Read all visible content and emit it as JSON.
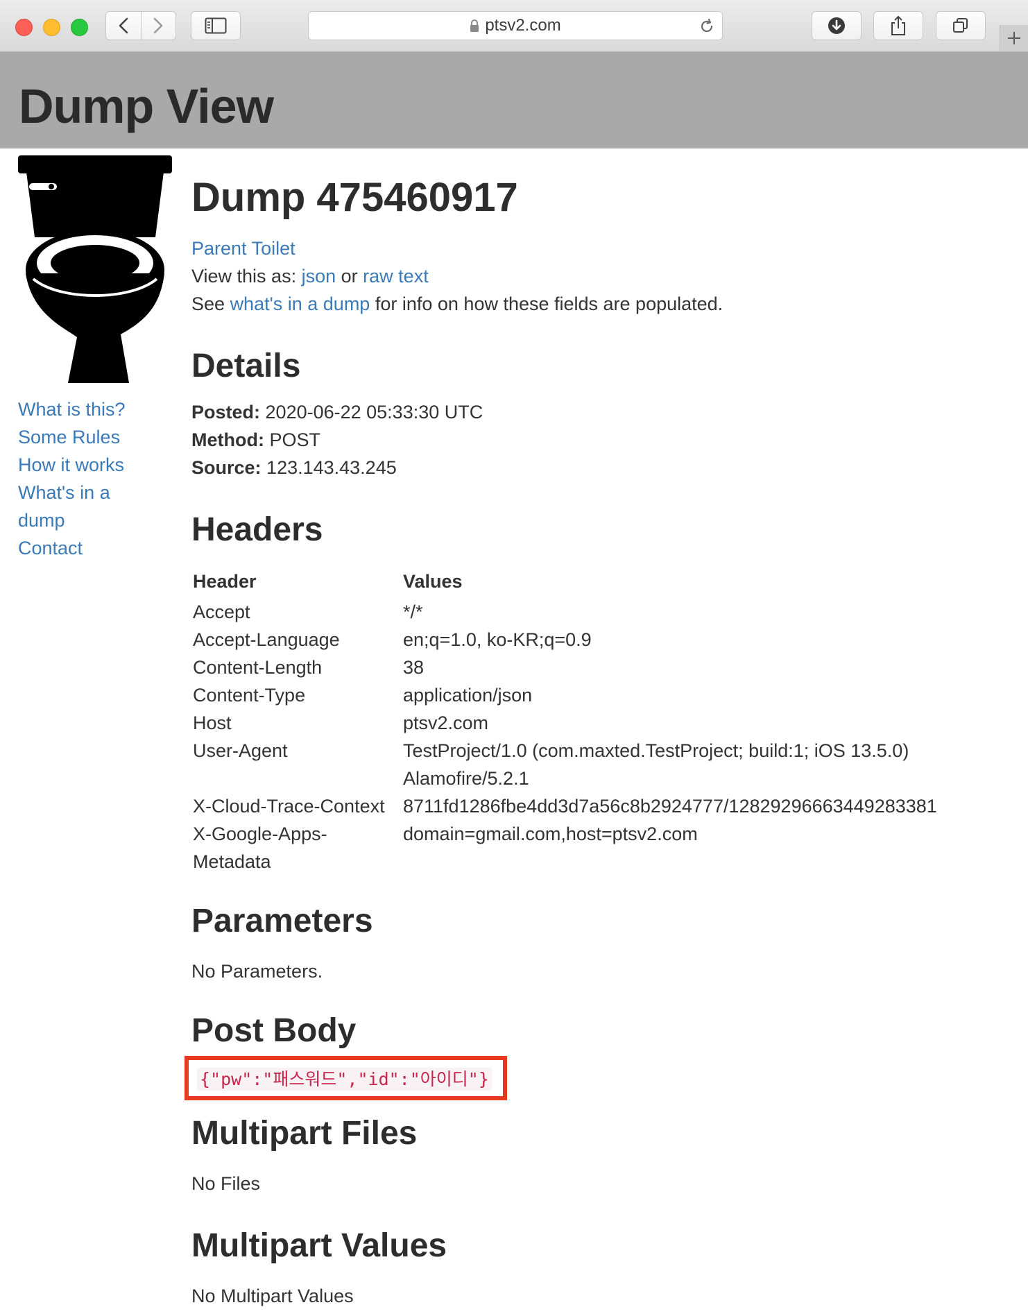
{
  "browser": {
    "url": "ptsv2.com"
  },
  "header": {
    "title": "Dump View"
  },
  "sidebar": {
    "links": [
      {
        "label": "What is this?"
      },
      {
        "label": "Some Rules"
      },
      {
        "label": "How it works"
      },
      {
        "label": "What's in a dump"
      },
      {
        "label": "Contact"
      }
    ]
  },
  "dump": {
    "title": "Dump 475460917",
    "parent_link": "Parent Toilet",
    "view_as_prefix": "View this as:",
    "json_link": "json",
    "or_text": "or",
    "raw_link": "raw text",
    "see_prefix": "See",
    "whats_link": "what's in a dump",
    "see_suffix": "for info on how these fields are populated."
  },
  "details": {
    "heading": "Details",
    "posted_label": "Posted:",
    "posted_value": "2020-06-22 05:33:30 UTC",
    "method_label": "Method:",
    "method_value": "POST",
    "source_label": "Source:",
    "source_value": "123.143.43.245"
  },
  "headers": {
    "heading": "Headers",
    "col_header": "Header",
    "col_values": "Values",
    "rows": [
      {
        "name": "Accept",
        "value": "*/*"
      },
      {
        "name": "Accept-Language",
        "value": "en;q=1.0, ko-KR;q=0.9"
      },
      {
        "name": "Content-Length",
        "value": "38"
      },
      {
        "name": "Content-Type",
        "value": "application/json"
      },
      {
        "name": "Host",
        "value": "ptsv2.com"
      },
      {
        "name": "User-Agent",
        "value": "TestProject/1.0 (com.maxted.TestProject; build:1; iOS 13.5.0) Alamofire/5.2.1"
      },
      {
        "name": "X-Cloud-Trace-Context",
        "value": "8711fd1286fbe4dd3d7a56c8b2924777/12829296663449283381"
      },
      {
        "name": "X-Google-Apps-Metadata",
        "value": "domain=gmail.com,host=ptsv2.com"
      }
    ]
  },
  "parameters": {
    "heading": "Parameters",
    "text": "No Parameters."
  },
  "post_body": {
    "heading": "Post Body",
    "content": "{\"pw\":\"패스워드\",\"id\":\"아이디\"}"
  },
  "multipart_files": {
    "heading": "Multipart Files",
    "text": "No Files"
  },
  "multipart_values": {
    "heading": "Multipart Values",
    "text": "No Multipart Values"
  },
  "colors": {
    "link": "#3b7ab8",
    "header_bg": "#a9a9a9",
    "highlight_box": "#e7391f",
    "code_text": "#c7254e"
  }
}
